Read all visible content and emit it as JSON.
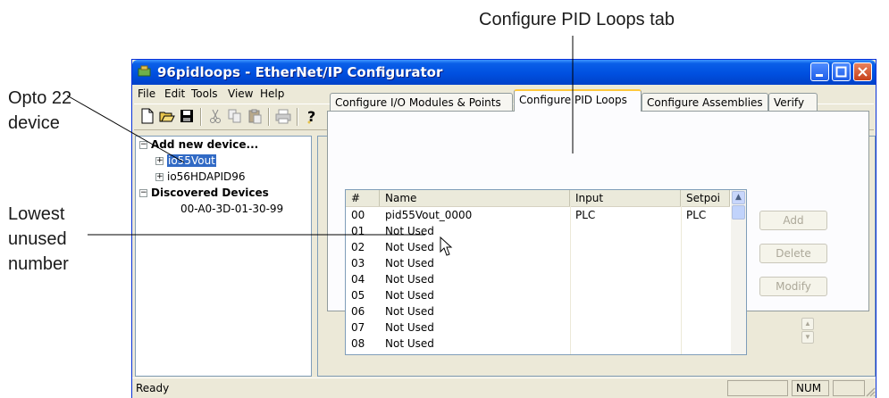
{
  "callouts": {
    "tab_label": "Configure PID Loops tab",
    "device_line1": "Opto 22",
    "device_line2": "device",
    "lowest_line1": "Lowest",
    "lowest_line2": "unused",
    "lowest_line3": "number"
  },
  "window": {
    "title": "96pidloops - EtherNet/IP Configurator",
    "title_color": "#0054e3"
  },
  "menu": [
    "File",
    "Edit",
    "Tools",
    "View",
    "Help"
  ],
  "toolbar_icons": [
    "new-icon",
    "open-icon",
    "save-icon",
    "cut-icon",
    "copy-icon",
    "paste-icon",
    "print-icon",
    "help-icon"
  ],
  "tree": {
    "add_new": "Add new device...",
    "devices": [
      "io55Vout",
      "io56HDAPID96"
    ],
    "discovered": "Discovered Devices",
    "discovered_items": [
      "00-A0-3D-01-30-99"
    ]
  },
  "tabs": [
    "Configure I/O Modules & Points",
    "Configure PID Loops",
    "Configure Assemblies",
    "Verify"
  ],
  "active_tab": "Configure PID Loops",
  "list": {
    "columns": [
      "#",
      "Name",
      "Input",
      "Setpoi"
    ],
    "rows": [
      [
        "00",
        "pid55Vout_0000",
        "PLC",
        "PLC"
      ],
      [
        "01",
        "Not Used",
        "",
        ""
      ],
      [
        "02",
        "Not Used",
        "",
        ""
      ],
      [
        "03",
        "Not Used",
        "",
        ""
      ],
      [
        "04",
        "Not Used",
        "",
        ""
      ],
      [
        "05",
        "Not Used",
        "",
        ""
      ],
      [
        "06",
        "Not Used",
        "",
        ""
      ],
      [
        "07",
        "Not Used",
        "",
        ""
      ],
      [
        "08",
        "Not Used",
        "",
        ""
      ]
    ]
  },
  "buttons": {
    "add": "Add",
    "delete": "Delete",
    "modify": "Modify"
  },
  "status": {
    "text": "Ready",
    "num": "NUM"
  }
}
